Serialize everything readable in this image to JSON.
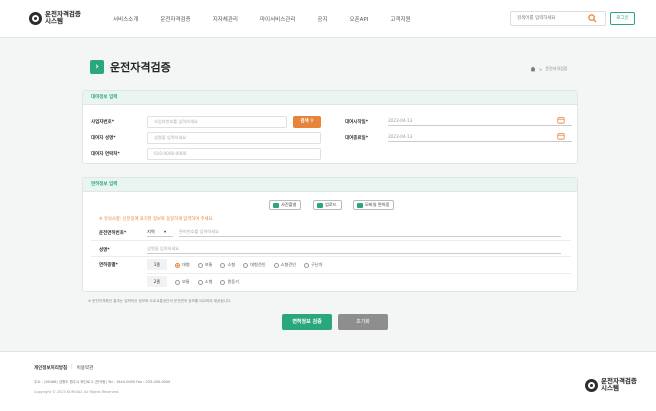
{
  "header": {
    "logo_line1": "운전자격검증",
    "logo_line2": "시스템",
    "nav": [
      "서비스소개",
      "운전자격검증",
      "지자체관리",
      "마이서비스관리",
      "공지",
      "오픈API",
      "고객지원"
    ],
    "search_placeholder": "검색어를 입력하세요",
    "login_label": "로그인"
  },
  "page": {
    "title": "운전자격검증",
    "breadcrumb": "운전자격검증"
  },
  "basic": {
    "heading": "대여정보 입력",
    "biz_label": "사업자번호*",
    "biz_placeholder": "사업자번호를 입력하세요",
    "search_label": "검색",
    "name_label": "대여자 성명*",
    "name_placeholder": "성명을 입력하세요",
    "phone_label": "대여자 연락처*",
    "phone_placeholder": "010-0000-0000",
    "start_label": "대여시작일*",
    "start_value": "2023-04-13",
    "end_label": "대여종료일*",
    "end_value": "2023-04-13"
  },
  "license": {
    "heading": "면허정보 입력",
    "btn_photo": "사진촬영",
    "btn_upload": "업로드",
    "btn_mobile": "모바일 면허증",
    "notice": "※ 유의사항: 신분증에 표기된 정보와 동일하게 입력하여 주세요.",
    "license_no_label": "운전면허번호*",
    "region_value": "지역",
    "license_no_placeholder": "면허번호를 입력하세요",
    "holder_label": "성명*",
    "holder_placeholder": "성명을 입력하세요",
    "type_label": "면허종별*",
    "class1_label": "1종",
    "class1_options": [
      "대형",
      "보통",
      "소형",
      "대형견인",
      "소형견인",
      "구난차"
    ],
    "class2_label": "2종",
    "class2_options": [
      "보통",
      "소형",
      "원동기"
    ]
  },
  "footnote": "※ 운전자격확인 결과는 입력하신 정보와 도로교통공단의 운전면허 정보를 비교하여 제공됩니다.",
  "actions": {
    "verify": "면허정보 검증",
    "reset": "초기화"
  },
  "footer": {
    "link1": "개인정보처리방침",
    "sep": "|",
    "link2": "이용약관",
    "address": "주소 : (26466) 강원도 원주시 혁신로 2 (반곡동)   Tel : 1644-0000   Fax : 033-000-0000",
    "copyright": "Copyright © 2023 KOROAD. All Rights Reserved."
  },
  "colors": {
    "primary": "#2aa87c",
    "accent": "#e8833a"
  }
}
